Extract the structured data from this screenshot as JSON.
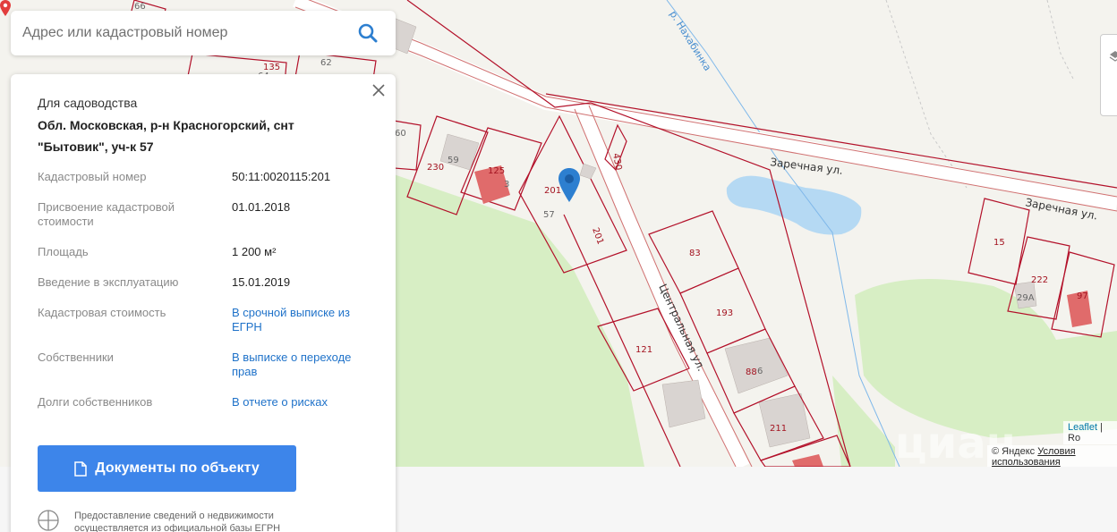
{
  "search": {
    "placeholder": "Адрес или кадастровый номер"
  },
  "info": {
    "purpose": "Для садоводства",
    "address": "Обл. Московская, р-н Красногорский, снт \"Бытовик\", уч-к 57",
    "rows": [
      {
        "label": "Кадастровый номер",
        "value": "50:11:0020115:201",
        "link": false
      },
      {
        "label": "Присвоение кадастровой стоимости",
        "value": "01.01.2018",
        "link": false
      },
      {
        "label": "Площадь",
        "value": "1 200 м²",
        "link": false
      },
      {
        "label": "Введение в эксплуатацию",
        "value": "15.01.2019",
        "link": false
      },
      {
        "label": "Кадастровая стоимость",
        "value": "В срочной выписке из ЕГРН",
        "link": true
      },
      {
        "label": "Собственники",
        "value": "В выписке о переходе прав",
        "link": true
      },
      {
        "label": "Долги собственников",
        "value": "В отчете о рисках",
        "link": true
      }
    ],
    "docs_button": "Документы по объекту",
    "note": "Предоставление сведений о недвижимости осуществляется из официальной базы ЕГРН"
  },
  "map": {
    "streets": {
      "zarechnaya": "Заречная ул.",
      "zarechnaya2": "Заречная ул.",
      "tsentralnaya": "Центральная ул.",
      "river": "р. Нахабинка"
    },
    "parcel_labels": [
      "66",
      "135",
      "62",
      "64",
      "60",
      "230",
      "59",
      "125",
      "201",
      "57",
      "201",
      "430",
      "83",
      "193",
      "121",
      "88",
      "6",
      "211",
      "15",
      "222",
      "29А",
      "97",
      "3"
    ],
    "attribution": {
      "leaflet": "Leaflet",
      "sep": " | Ro",
      "yandex": "© Яндекс",
      "terms": "Условия использования"
    },
    "watermark": "циан"
  },
  "colors": {
    "accent": "#3d85ea",
    "link": "#1f72c9",
    "parcel": "#b3112a",
    "water": "#b5d9f3",
    "green": "#d6eec2"
  }
}
